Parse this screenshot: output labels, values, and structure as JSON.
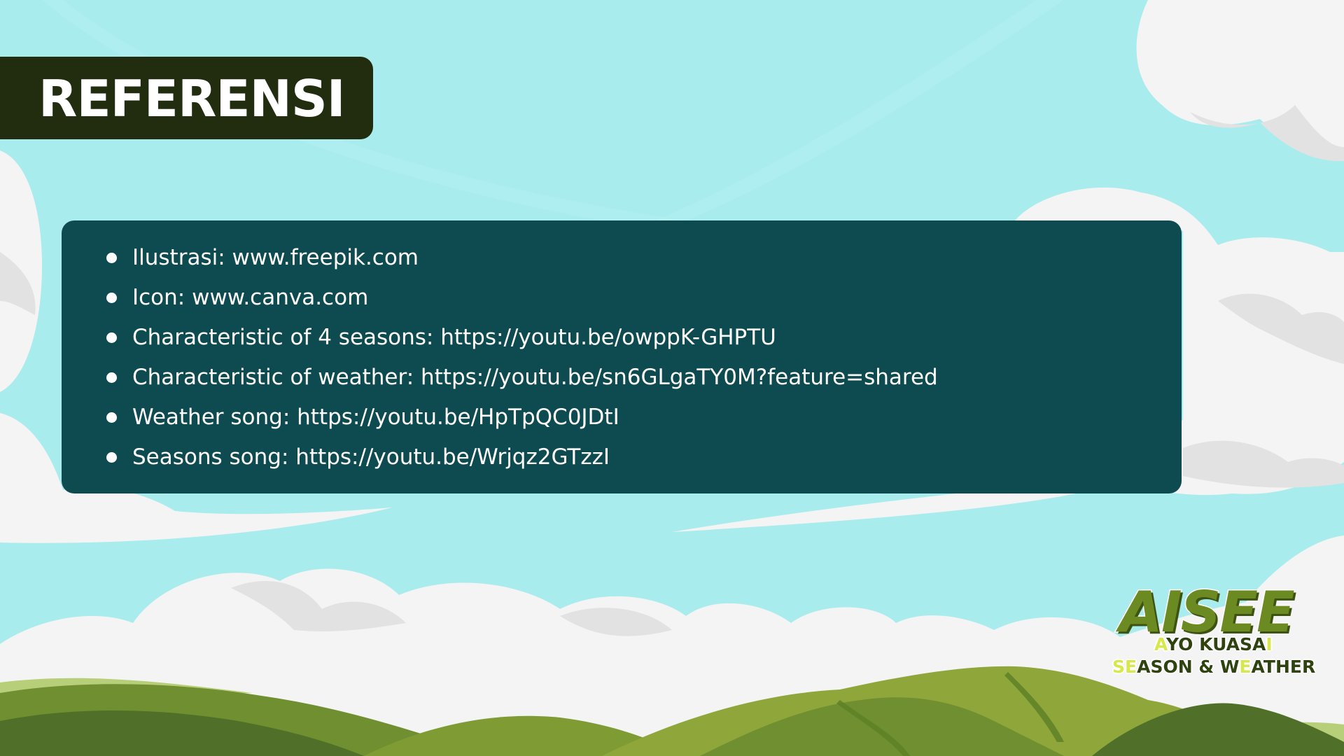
{
  "slide": {
    "title": "REFERENSI",
    "colors": {
      "sky": "#a9ecee",
      "title_box": "#222d10",
      "panel": "#0d4b50",
      "cloud": "#f4f4f4",
      "cloud_shadow": "#e2e2e2",
      "hill_light": "#8ea63a",
      "hill_dark": "#50702a",
      "logo_green": "#6c8a22",
      "logo_highlight": "#d7e84a"
    },
    "references": [
      "Ilustrasi: www.freepik.com",
      "Icon: www.canva.com",
      "Characteristic of 4 seasons: https://youtu.be/owppK-GHPTU",
      "Characteristic of weather: https://youtu.be/sn6GLgaTY0M?feature=shared",
      "Weather song: https://youtu.be/HpTpQC0JDtI",
      "Seasons song: https://youtu.be/Wrjqz2GTzzI"
    ]
  },
  "logo": {
    "main": "AISEE",
    "line1_accent": "A",
    "line1_rest": "YO KUASA",
    "line1_end": "I",
    "line2_accent1": "SE",
    "line2_mid": "ASON & W",
    "line2_accent2": "E",
    "line2_end": "ATHER"
  }
}
